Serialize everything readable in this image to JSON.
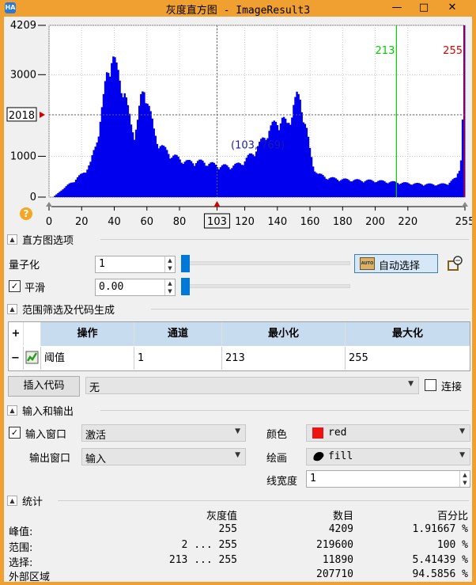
{
  "window": {
    "title": "灰度直方图 - ImageResult3",
    "icon_label": "HA",
    "controls": [
      "—",
      "□",
      "✕"
    ]
  },
  "chart_data": {
    "type": "bar",
    "x_range": [
      0,
      255
    ],
    "ylim": [
      0,
      4209
    ],
    "x_ticks": [
      0,
      20,
      40,
      60,
      80,
      100,
      120,
      140,
      160,
      180,
      200,
      220,
      255
    ],
    "x_tick_labels": [
      "0",
      "20",
      "40",
      "60",
      "80",
      "103",
      "120",
      "140",
      "160",
      "180",
      "200",
      "220",
      "255"
    ],
    "y_ticks": [
      0,
      1000,
      2018,
      3000,
      4209
    ],
    "y_tick_labels": [
      "0",
      "1000",
      "2018",
      "3000",
      "4209"
    ],
    "cursor": {
      "x": 103,
      "y": 769,
      "label": "(103, 769)"
    },
    "y_marker": {
      "value": 2018,
      "label": "2018"
    },
    "threshold_lines": [
      {
        "x": 213,
        "label": "213",
        "color": "#00cc00"
      },
      {
        "x": 255,
        "label": "255",
        "color": "#dd0000"
      }
    ],
    "bar_color": "#0000ee",
    "grid": true,
    "profile_x": [
      0,
      2,
      5,
      10,
      15,
      20,
      25,
      28,
      30,
      33,
      35,
      37,
      38,
      39,
      40,
      41,
      42,
      44,
      46,
      48,
      50,
      52,
      54,
      56,
      58,
      60,
      62,
      64,
      66,
      68,
      70,
      75,
      80,
      85,
      90,
      95,
      100,
      105,
      110,
      115,
      120,
      125,
      130,
      135,
      140,
      143,
      146,
      148,
      150,
      152,
      154,
      156,
      158,
      160,
      162,
      165,
      170,
      175,
      180,
      190,
      200,
      210,
      220,
      230,
      240,
      245,
      250,
      252,
      253,
      254,
      255
    ],
    "profile_y": [
      0,
      0,
      100,
      250,
      400,
      550,
      800,
      1200,
      1600,
      2300,
      2900,
      3250,
      3370,
      3300,
      3150,
      3000,
      2900,
      2700,
      2500,
      2050,
      1700,
      1550,
      1800,
      2300,
      2550,
      2400,
      1950,
      1550,
      1350,
      1250,
      1150,
      1000,
      900,
      830,
      850,
      830,
      780,
      740,
      730,
      760,
      870,
      1050,
      1300,
      1600,
      1800,
      1850,
      1700,
      1900,
      2200,
      2350,
      2300,
      2000,
      1600,
      1100,
      750,
      550,
      470,
      440,
      420,
      400,
      390,
      360,
      330,
      310,
      300,
      330,
      450,
      700,
      900,
      1900,
      4209
    ]
  },
  "help_icon": "?",
  "hist_options": {
    "section_title": "直方图选项",
    "quantize_label": "量子化",
    "quantize_value": "1",
    "smooth_label": "平滑",
    "smooth_checked": "✓",
    "smooth_value": "0.00",
    "auto_select_label": "自动选择",
    "auto_icon_text": "AUTO",
    "quantize_slider_fraction": 0.0,
    "smooth_slider_fraction": 0.0
  },
  "range_section": {
    "section_title": "范围筛选及代码生成",
    "table": {
      "add_btn": "+",
      "remove_btn": "−",
      "headers": [
        "操作",
        "通道",
        "最小化",
        "最大化"
      ],
      "row": [
        "阈值",
        "1",
        "213",
        "255"
      ]
    },
    "insert_code_label": "插入代码",
    "code_type_value": "无",
    "connect_label": "连接"
  },
  "io_section": {
    "section_title": "输入和输出",
    "input_window_label": "输入窗口",
    "input_window_checked": "✓",
    "input_window_value": "激活",
    "output_window_label": "输出窗口",
    "output_window_value": "输入",
    "color_label": "颜色",
    "color_value": "red",
    "color_swatch": "#ee1111",
    "draw_label": "绘画",
    "draw_value": "fill",
    "line_width_label": "线宽度",
    "line_width_value": "1"
  },
  "stats_section": {
    "section_title": "统计",
    "headers": [
      "灰度值",
      "数目",
      "百分比"
    ],
    "rows": [
      {
        "label": "峰值:",
        "gray": "255",
        "count": "4209",
        "pct": "1.91667 %"
      },
      {
        "label": "范围:",
        "gray": "2 ... 255",
        "count": "219600",
        "pct": "100 %"
      },
      {
        "label": "选择:",
        "gray": "213 ... 255",
        "count": "11890",
        "pct": "5.41439 %"
      },
      {
        "label": "外部区域",
        "gray": "",
        "count": "207710",
        "pct": "94.5856 %"
      }
    ]
  }
}
